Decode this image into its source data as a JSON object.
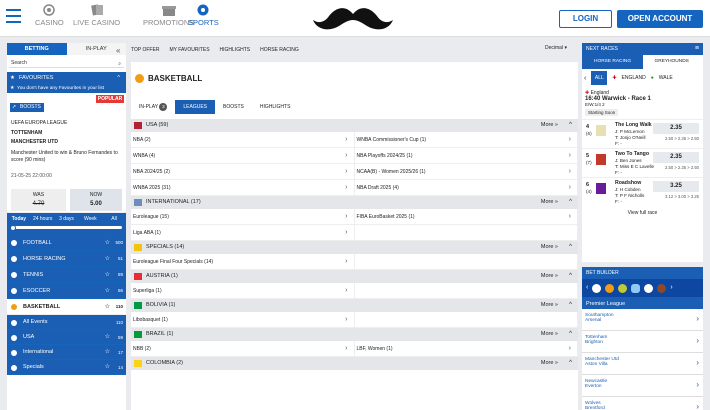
{
  "header": {
    "nav": [
      {
        "label": "CASINO",
        "icon": "casino-chip-icon"
      },
      {
        "label": "LIVE CASINO",
        "icon": "cards-icon"
      },
      {
        "label": "PROMOTIONS",
        "icon": "gift-icon"
      },
      {
        "label": "SPORTS",
        "icon": "football-icon"
      }
    ],
    "login": "LOGIN",
    "open_account": "OPEN ACCOUNT"
  },
  "left": {
    "tab_betting": "BETTING",
    "tab_inplay": "IN-PLAY",
    "search_label": "Search",
    "favourites": "FAVOURITES",
    "fav_note": "You don't have any Favourites in your list",
    "boost": {
      "tag": "BOOSTS",
      "popular": "POPULAR",
      "league": "UEFA EUROPA LEAGUE",
      "team1": "TOTTENHAM",
      "team2": "MANCHESTER UTD",
      "desc": "Manchester United to win & Bruno Fernandes to score (90 mins)",
      "date": "21-05-25 22:00:00",
      "was_label": "WAS",
      "was_value": "4.70",
      "now_label": "NOW",
      "now_value": "5.00"
    },
    "time_filters": [
      "Today",
      "24 hours",
      "3 days",
      "Week",
      "All"
    ],
    "sports": [
      {
        "name": "FOOTBALL",
        "count": "500"
      },
      {
        "name": "HORSE RACING",
        "count": "51"
      },
      {
        "name": "TENNIS",
        "count": "89"
      },
      {
        "name": "ESOCCER",
        "count": "86"
      }
    ],
    "basketball": {
      "name": "BASKETBALL",
      "count": "110"
    },
    "sub": [
      {
        "name": "All Events",
        "count": "110"
      },
      {
        "name": "USA",
        "count": "59"
      },
      {
        "name": "International",
        "count": "17"
      },
      {
        "name": "Specials",
        "count": "14"
      }
    ]
  },
  "main": {
    "topnav": [
      "TOP OFFER",
      "MY FAVOURITES",
      "HIGHLIGHTS",
      "HORSE RACING"
    ],
    "odds_format": "Decimal",
    "title": "BASKETBALL",
    "subtabs": {
      "inplay": "IN-PLAY",
      "inplay_count": "3",
      "leagues": "LEAGUES",
      "boosts": "BOOSTS",
      "highlights": "HIGHLIGHTS"
    },
    "more": "More",
    "groups": [
      {
        "name": "USA (59)",
        "rows": [
          [
            "NBA (2)",
            "WNBA Commissioner's Cup (1)"
          ],
          [
            "WNBA (4)",
            "NBA Playoffs 2024/25 (1)"
          ],
          [
            "NBA 2024/25 (2)",
            "NCAA(B) - Women 2025/26 (1)"
          ],
          [
            "WNBA 2025 (31)",
            "NBA Draft 2025 (4)"
          ]
        ]
      },
      {
        "name": "INTERNATIONAL (17)",
        "rows": [
          [
            "Euroleague (15)",
            "FIBA EuroBasket 2025 (1)"
          ],
          [
            "Liga ABA (1)",
            ""
          ]
        ]
      },
      {
        "name": "SPECIALS (14)",
        "rows": [
          [
            "Euroleague Final Four Specials (14)",
            ""
          ]
        ]
      },
      {
        "name": "AUSTRIA (1)",
        "rows": [
          [
            "Superliga (1)",
            ""
          ]
        ]
      },
      {
        "name": "BOLIVIA (1)",
        "rows": [
          [
            "Libobasquet (1)",
            ""
          ]
        ]
      },
      {
        "name": "BRAZIL (1)",
        "rows": [
          [
            "NBB (2)",
            "LBF, Women (1)"
          ]
        ]
      },
      {
        "name": "COLOMBIA (2)",
        "rows": []
      }
    ]
  },
  "right": {
    "next_races": "NEXT RACES",
    "tab_horse": "HORSE RACING",
    "tab_grey": "GREYHOUNDS",
    "flags": {
      "all": "ALL",
      "england": "ENGLAND",
      "wales": "WALE"
    },
    "race": {
      "country": "England",
      "title": "16:40 Warwick - Race 1",
      "terms": "E/W:1/4 2",
      "status": "Starting Soon"
    },
    "runners": [
      {
        "num": "4",
        "draw": "(6)",
        "name": "The Long Walk",
        "jockey": "J: P McLernon",
        "trainer": "T: Jonjo O'Neill",
        "form": "F: -",
        "odds": "2.35",
        "sub": "2.50 > 2.35 > 2.50"
      },
      {
        "num": "5",
        "draw": "(7)",
        "name": "Two To Tango",
        "jockey": "J: Ben Jones",
        "trainer": "T: Miss E C Lavelle",
        "form": "F: -",
        "odds": "2.35",
        "sub": "2.50 > 2.35 > 2.50"
      },
      {
        "num": "6",
        "draw": "(4)",
        "name": "Roadshow",
        "jockey": "J: H Cobden",
        "trainer": "T: P F Nicholls",
        "form": "F: -",
        "odds": "3.25",
        "sub": "3.12 > 3.00 > 3.25"
      }
    ],
    "view_full": "View full race",
    "bet_builder": "BET BUILDER",
    "league": "Premier League",
    "matches": [
      [
        "Southampton",
        "Arsenal"
      ],
      [
        "Tottenham",
        "Brighton"
      ],
      [
        "Manchester Utd",
        "Aston Villa"
      ],
      [
        "Newcastle",
        "Everton"
      ],
      [
        "Wolves",
        "Brentford"
      ]
    ]
  },
  "colors": {
    "brand": "#1a5fb4",
    "popular": "#e53935",
    "basketball": "#f39c12"
  }
}
